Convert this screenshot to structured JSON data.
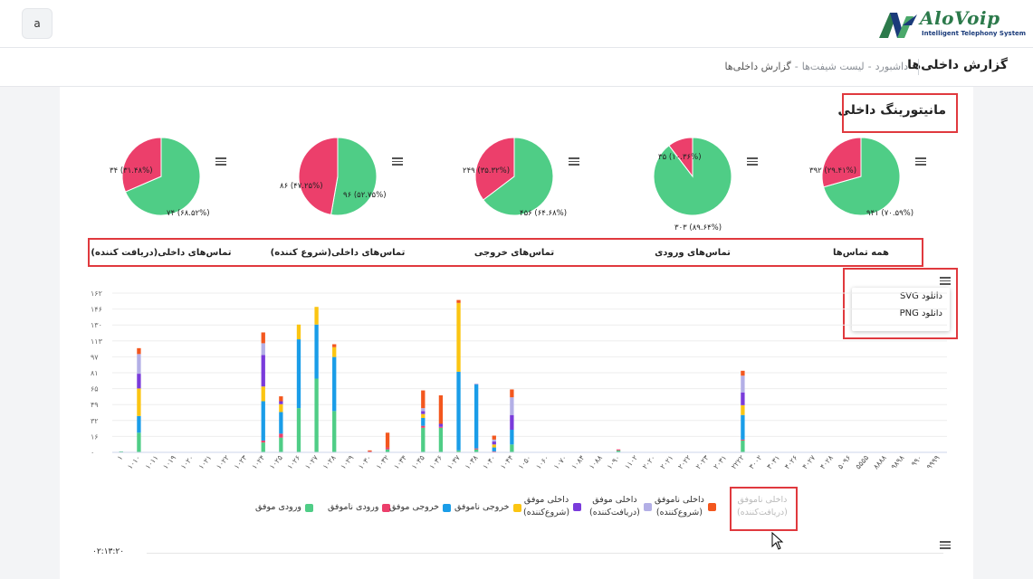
{
  "header": {
    "avatar_letter": "a",
    "logo_name": "AloVoip",
    "logo_tagline": "Intelligent Telephony System"
  },
  "page": {
    "title": "گزارش داخلی‌ها",
    "breadcrumb": [
      "داشبورد",
      "لیست شیفت‌ها",
      "گزارش داخلی‌ها"
    ],
    "breadcrumb_sep": "-"
  },
  "section": {
    "title": "مانیتورینگ داخلی"
  },
  "colors": {
    "green": "#4fcd86",
    "pink": "#ec3f6b",
    "blue": "#1a9de8",
    "yellow": "#fbc512",
    "purple": "#7a3bdb",
    "lavender": "#b3afe6",
    "orange": "#f3571e",
    "highlight": "#e0393e"
  },
  "pies": [
    {
      "title": "همه تماس‌ها",
      "slices": [
        {
          "label": "۹۴۱ (۷۰.۵۹%)",
          "value": 70.59,
          "color": "green"
        },
        {
          "label": "۳۹۲ (۲۹.۴۱%)",
          "value": 29.41,
          "color": "pink"
        }
      ]
    },
    {
      "title": "تماس‌های ورودی",
      "slices": [
        {
          "label": "۳۰۳ (۸۹.۶۴%)",
          "value": 89.64,
          "color": "green"
        },
        {
          "label": "۳۵ (۱۰.۳۶%)",
          "value": 10.36,
          "color": "pink"
        }
      ]
    },
    {
      "title": "تماس‌های خروجی",
      "slices": [
        {
          "label": "۴۵۶ (۶۴.۶۸%)",
          "value": 64.68,
          "color": "green"
        },
        {
          "label": "۲۴۹ (۳۵.۳۲%)",
          "value": 35.32,
          "color": "pink"
        }
      ]
    },
    {
      "title": "تماس‌های داخلی(شروع کننده)",
      "slices": [
        {
          "label": "۹۶ (۵۲.۷۵%)",
          "value": 52.75,
          "color": "green"
        },
        {
          "label": "۸۶ (۴۷.۲۵%)",
          "value": 47.25,
          "color": "pink"
        }
      ]
    },
    {
      "title": "تماس‌های داخلی(دریافت کننده)",
      "slices": [
        {
          "label": "۷۴ (۶۸.۵۲%)",
          "value": 68.52,
          "color": "green"
        },
        {
          "label": "۳۴ (۳۱.۴۸%)",
          "value": 31.48,
          "color": "pink"
        }
      ]
    }
  ],
  "export_menu": {
    "items": [
      "دانلود SVG",
      "دانلود PNG"
    ]
  },
  "chart_data": {
    "type": "bar",
    "stacked": true,
    "y_ticks": [
      "۰",
      "۱۶",
      "۳۲",
      "۴۹",
      "۶۵",
      "۸۱",
      "۹۷",
      "۱۱۳",
      "۱۳۰",
      "۱۴۶",
      "۱۶۲"
    ],
    "ylim": [
      0,
      162
    ],
    "categories": [
      "۱",
      "۱۰۱۰",
      "۱۰۱۱",
      "۱۰۱۹",
      "۱۰۲۰",
      "۱۰۲۱",
      "۱۰۲۲",
      "۱۰۲۳",
      "۱۰۲۴",
      "۱۰۲۵",
      "۱۰۲۶",
      "۱۰۲۷",
      "۱۰۲۸",
      "۱۰۲۹",
      "۱۰۳۰",
      "۱۰۳۲",
      "۱۰۳۴",
      "۱۰۳۵",
      "۱۰۳۶",
      "۱۰۳۷",
      "۱۰۳۸",
      "۱۰۴۰",
      "۱۰۴۴",
      "۱۰۵۰",
      "۱۰۶۰",
      "۱۰۷۰",
      "۱۰۸۴",
      "۱۰۸۸",
      "۱۰۹۰",
      "۱۱۰۲",
      "۲۰۲۰",
      "۲۰۲۱",
      "۲۰۲۲",
      "۲۰۲۳",
      "۲۰۳۱",
      "۲۲۲۲",
      "۳۰۰۲",
      "۳۰۳۱",
      "۴۰۲۶",
      "۴۰۲۷",
      "۴۰۲۸",
      "۵۰۹۶",
      "۵۵۵۵",
      "۸۸۸۸",
      "۹۸۹۸",
      "۹۹۰",
      "۹۹۹۹"
    ],
    "series": [
      {
        "name": "ورودی موفق",
        "color": "green",
        "values": [
          1,
          20,
          0,
          0,
          0,
          0,
          0,
          0,
          10,
          15,
          45,
          75,
          42,
          0,
          0,
          3,
          0,
          25,
          25,
          2,
          3,
          0,
          8,
          0,
          0,
          0,
          0,
          0,
          2,
          0,
          0,
          0,
          0,
          0,
          0,
          12,
          0,
          0,
          0,
          0,
          0,
          0,
          0,
          0,
          0,
          0,
          0
        ]
      },
      {
        "name": "ورودی ناموفق",
        "color": "pink",
        "values": [
          0,
          0,
          0,
          0,
          0,
          0,
          0,
          0,
          2,
          4,
          0,
          0,
          0,
          0,
          1,
          2,
          0,
          2,
          1,
          0,
          1,
          1,
          0,
          0,
          0,
          0,
          0,
          0,
          1,
          0,
          0,
          0,
          0,
          0,
          0,
          1,
          0,
          0,
          0,
          0,
          0,
          0,
          0,
          0,
          0,
          0,
          0
        ]
      },
      {
        "name": "خروجی موفق",
        "color": "blue",
        "values": [
          0,
          17,
          0,
          0,
          0,
          0,
          0,
          0,
          40,
          22,
          70,
          55,
          55,
          0,
          0,
          0,
          0,
          8,
          0,
          80,
          65,
          4,
          15,
          0,
          0,
          0,
          0,
          0,
          0,
          0,
          0,
          0,
          0,
          0,
          0,
          25,
          0,
          0,
          0,
          0,
          0,
          0,
          0,
          0,
          0,
          0,
          0
        ]
      },
      {
        "name": "خروجی ناموفق",
        "color": "yellow",
        "values": [
          0,
          28,
          0,
          0,
          0,
          0,
          0,
          0,
          15,
          8,
          15,
          18,
          10,
          0,
          0,
          0,
          0,
          4,
          0,
          70,
          0,
          3,
          0,
          0,
          0,
          0,
          0,
          0,
          0,
          0,
          0,
          0,
          0,
          0,
          0,
          10,
          0,
          0,
          0,
          0,
          0,
          0,
          0,
          0,
          0,
          0,
          0
        ]
      },
      {
        "name": "داخلی موفق\n(شروع‌کننده)",
        "color": "purple",
        "values": [
          0,
          15,
          0,
          0,
          0,
          0,
          0,
          0,
          32,
          3,
          0,
          0,
          0,
          0,
          0,
          0,
          0,
          3,
          3,
          0,
          0,
          3,
          15,
          0,
          0,
          0,
          0,
          0,
          0,
          0,
          0,
          0,
          0,
          0,
          0,
          13,
          0,
          0,
          0,
          0,
          0,
          0,
          0,
          0,
          0,
          0,
          0
        ]
      },
      {
        "name": "داخلی موفق\n(دریافت‌کننده)",
        "color": "lavender",
        "values": [
          0,
          20,
          0,
          0,
          0,
          0,
          0,
          0,
          12,
          0,
          0,
          0,
          0,
          0,
          0,
          0,
          0,
          3,
          0,
          0,
          1,
          2,
          18,
          0,
          0,
          0,
          0,
          0,
          0,
          0,
          0,
          0,
          0,
          0,
          0,
          17,
          0,
          0,
          0,
          0,
          0,
          0,
          0,
          0,
          0,
          0,
          0
        ]
      },
      {
        "name": "داخلی ناموفق\n(شروع‌کننده)",
        "color": "orange",
        "values": [
          0,
          6,
          0,
          0,
          0,
          0,
          0,
          0,
          11,
          5,
          0,
          0,
          3,
          0,
          1,
          15,
          0,
          18,
          29,
          3,
          0,
          4,
          8,
          0,
          0,
          0,
          0,
          0,
          0,
          0,
          0,
          0,
          0,
          0,
          0,
          5,
          0,
          0,
          0,
          0,
          0,
          0,
          0,
          0,
          0,
          0,
          0
        ]
      },
      {
        "name": "داخلی ناموفق\n(دریافت‌کننده)",
        "color": "lavender",
        "hidden": true,
        "values": [
          0,
          0,
          0,
          0,
          0,
          0,
          0,
          0,
          0,
          0,
          0,
          0,
          0,
          0,
          0,
          0,
          0,
          0,
          0,
          0,
          0,
          0,
          0,
          0,
          0,
          0,
          0,
          0,
          0,
          0,
          0,
          0,
          0,
          0,
          0,
          0,
          0,
          0,
          0,
          0,
          0,
          0,
          0,
          0,
          0,
          0,
          0
        ]
      }
    ]
  },
  "second_chart": {
    "first_tick": "۰۲:۱۳:۲۰"
  }
}
